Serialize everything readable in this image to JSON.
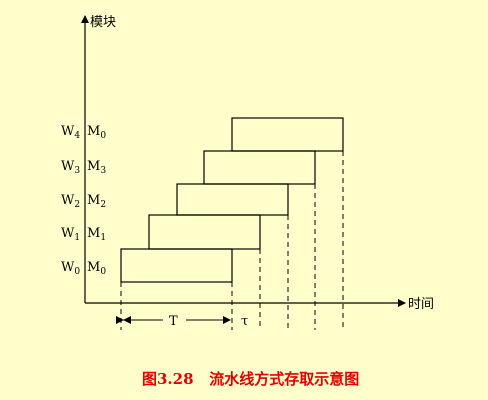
{
  "diagram": {
    "y_axis_label": "模块",
    "x_axis_label": "时间",
    "period_label": "T",
    "tau_label": "τ",
    "rows": [
      {
        "w": "W",
        "w_sub": "0",
        "m": "M",
        "m_sub": "0"
      },
      {
        "w": "W",
        "w_sub": "1",
        "m": "M",
        "m_sub": "1"
      },
      {
        "w": "W",
        "w_sub": "2",
        "m": "M",
        "m_sub": "2"
      },
      {
        "w": "W",
        "w_sub": "3",
        "m": "M",
        "m_sub": "3"
      },
      {
        "w": "W",
        "w_sub": "4",
        "m": "M",
        "m_sub": "0"
      }
    ]
  },
  "caption": "图3.28   流水线方式存取示意图",
  "colors": {
    "background": "#FFFFCC",
    "caption": "#E00000",
    "ink": "#000000"
  }
}
